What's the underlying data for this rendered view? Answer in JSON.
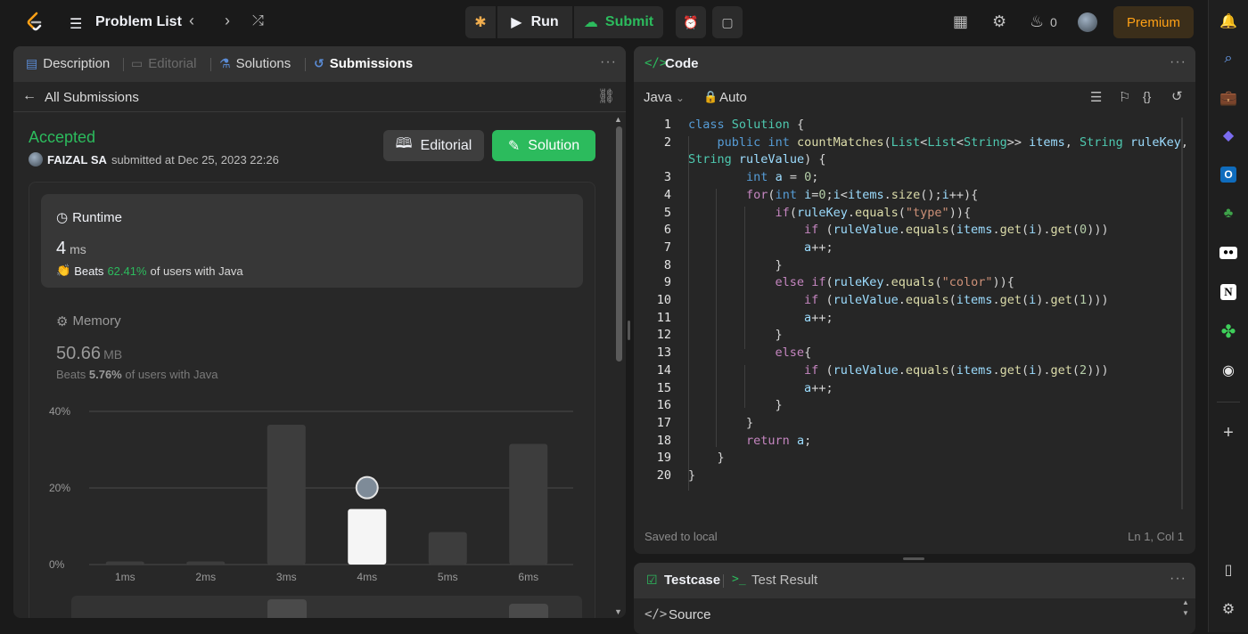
{
  "topbar": {
    "title": "Problem List",
    "run_label": "Run",
    "submit_label": "Submit",
    "streak_count": "0",
    "premium_label": "Premium"
  },
  "left_tabs": [
    {
      "label": "Description"
    },
    {
      "label": "Editorial"
    },
    {
      "label": "Solutions"
    },
    {
      "label": "Submissions"
    }
  ],
  "submission": {
    "back_label": "All Submissions",
    "status": "Accepted",
    "user": "FAIZAL SA",
    "submitted_text": "submitted at Dec 25, 2023 22:26",
    "editorial_button": "Editorial",
    "solution_button": "Solution"
  },
  "runtime": {
    "title": "Runtime",
    "value": "4",
    "unit": "ms",
    "beats_label": "Beats",
    "beats_pct": "62.41%",
    "beats_suffix": "of users with Java"
  },
  "memory": {
    "title": "Memory",
    "value": "50.66",
    "unit": "MB",
    "beats_label": "Beats",
    "beats_pct": "5.76%",
    "beats_suffix": "of users with Java"
  },
  "chart_data": {
    "type": "bar",
    "categories": [
      "1ms",
      "2ms",
      "3ms",
      "4ms",
      "5ms",
      "6ms"
    ],
    "values": [
      0.8,
      0.8,
      36.5,
      14.5,
      8.5,
      31.5
    ],
    "highlight_index": 3,
    "y_ticks": [
      "0%",
      "20%",
      "40%"
    ],
    "ylim": [
      0,
      40
    ],
    "grid": true,
    "colors": {
      "bar": "#3d3d3d",
      "highlight": "#f5f5f5"
    }
  },
  "code_panel": {
    "title": "Code",
    "language": "Java",
    "mode": "Auto",
    "saved_text": "Saved to local",
    "cursor_pos": "Ln 1, Col 1",
    "lines": [
      {
        "n": "1",
        "html": "<span class=\"kw\">class</span> <span class=\"cls\">Solution</span> {"
      },
      {
        "n": "2",
        "html": "    <span class=\"kw\">public</span> <span class=\"kw\">int</span> <span class=\"fn\">countMatches</span>(<span class=\"cls\">List</span>&lt;<span class=\"cls\">List</span>&lt;<span class=\"cls\">String</span>&gt;&gt; <span class=\"var\">items</span>, <span class=\"cls\">String</span> <span class=\"var\">ruleKey</span>,"
      },
      {
        "n": "",
        "html": "<span class=\"cls\">String</span> <span class=\"var\">ruleValue</span>) {"
      },
      {
        "n": "3",
        "html": "        <span class=\"kw\">int</span> <span class=\"var\">a</span> = <span class=\"num\">0</span>;"
      },
      {
        "n": "4",
        "html": "        <span class=\"ctl\">for</span>(<span class=\"kw\">int</span> <span class=\"var\">i</span>=<span class=\"num\">0</span>;<span class=\"var\">i</span>&lt;<span class=\"var\">items</span>.<span class=\"fn\">size</span>();<span class=\"var\">i</span>++){"
      },
      {
        "n": "5",
        "html": "            <span class=\"ctl\">if</span>(<span class=\"var\">ruleKey</span>.<span class=\"fn\">equals</span>(<span class=\"str\">\"type\"</span>)){"
      },
      {
        "n": "6",
        "html": "                <span class=\"ctl\">if</span> (<span class=\"var\">ruleValue</span>.<span class=\"fn\">equals</span>(<span class=\"var\">items</span>.<span class=\"fn\">get</span>(<span class=\"var\">i</span>).<span class=\"fn\">get</span>(<span class=\"num\">0</span>)))"
      },
      {
        "n": "7",
        "html": "                <span class=\"var\">a</span>++;"
      },
      {
        "n": "8",
        "html": "            }"
      },
      {
        "n": "9",
        "html": "            <span class=\"ctl\">else</span> <span class=\"ctl\">if</span>(<span class=\"var\">ruleKey</span>.<span class=\"fn\">equals</span>(<span class=\"str\">\"color\"</span>)){"
      },
      {
        "n": "10",
        "html": "                <span class=\"ctl\">if</span> (<span class=\"var\">ruleValue</span>.<span class=\"fn\">equals</span>(<span class=\"var\">items</span>.<span class=\"fn\">get</span>(<span class=\"var\">i</span>).<span class=\"fn\">get</span>(<span class=\"num\">1</span>)))"
      },
      {
        "n": "11",
        "html": "                <span class=\"var\">a</span>++;"
      },
      {
        "n": "12",
        "html": "            }"
      },
      {
        "n": "13",
        "html": "            <span class=\"ctl\">else</span>{"
      },
      {
        "n": "14",
        "html": "                <span class=\"ctl\">if</span> (<span class=\"var\">ruleValue</span>.<span class=\"fn\">equals</span>(<span class=\"var\">items</span>.<span class=\"fn\">get</span>(<span class=\"var\">i</span>).<span class=\"fn\">get</span>(<span class=\"num\">2</span>)))"
      },
      {
        "n": "15",
        "html": "                <span class=\"var\">a</span>++;"
      },
      {
        "n": "16",
        "html": "            }"
      },
      {
        "n": "17",
        "html": "        }"
      },
      {
        "n": "18",
        "html": "        <span class=\"ctl\">return</span> <span class=\"var\">a</span>;"
      },
      {
        "n": "19",
        "html": "    }"
      },
      {
        "n": "20",
        "html": "}"
      }
    ]
  },
  "testcase_panel": {
    "tab_testcase": "Testcase",
    "tab_result": "Test Result",
    "source_label": "Source"
  },
  "sidebar_icons": [
    "bell-icon",
    "search-icon",
    "briefcase-icon",
    "copilot-icon",
    "outlook-icon",
    "tree-icon",
    "medium-icon",
    "notion-icon",
    "clover-icon",
    "github-icon",
    "add-icon",
    "panel-icon",
    "settings-icon"
  ]
}
